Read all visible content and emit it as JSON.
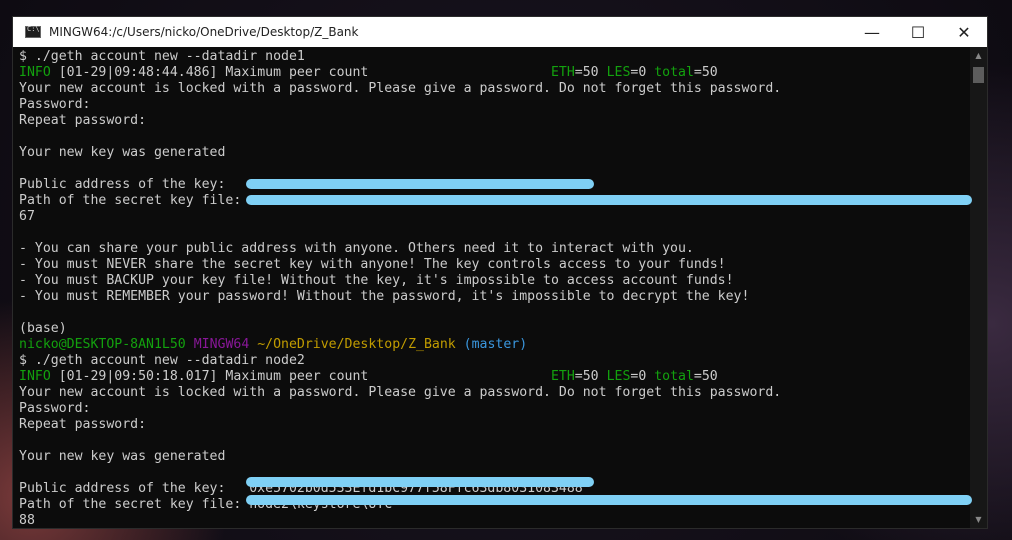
{
  "window": {
    "title": "MINGW64:/c/Users/nicko/OneDrive/Desktop/Z_Bank",
    "minimize": "—",
    "maximize": "☐",
    "close": "✕"
  },
  "terminal": {
    "lines": [
      {
        "kind": "cmd",
        "text": "$ ./geth account new --datadir node1"
      },
      {
        "kind": "info",
        "tag": "INFO",
        "text": " [01-29|09:48:44.486] Maximum peer count                       ",
        "k1": "ETH",
        "v1": "=50 ",
        "k2": "LES",
        "v2": "=0 ",
        "k3": "total",
        "v3": "=50"
      },
      {
        "kind": "plain",
        "text": "Your new account is locked with a password. Please give a password. Do not forget this password."
      },
      {
        "kind": "plain",
        "text": "Password:"
      },
      {
        "kind": "plain",
        "text": "Repeat password:"
      },
      {
        "kind": "plain",
        "text": ""
      },
      {
        "kind": "plain",
        "text": "Your new key was generated"
      },
      {
        "kind": "plain",
        "text": ""
      },
      {
        "kind": "plain",
        "text": "Public address of the key:"
      },
      {
        "kind": "plain",
        "text": "Path of the secret key file:"
      },
      {
        "kind": "plain",
        "text": "67"
      },
      {
        "kind": "plain",
        "text": ""
      },
      {
        "kind": "plain",
        "text": "- You can share your public address with anyone. Others need it to interact with you."
      },
      {
        "kind": "plain",
        "text": "- You must NEVER share the secret key with anyone! The key controls access to your funds!"
      },
      {
        "kind": "plain",
        "text": "- You must BACKUP your key file! Without the key, it's impossible to access account funds!"
      },
      {
        "kind": "plain",
        "text": "- You must REMEMBER your password! Without the password, it's impossible to decrypt the key!"
      },
      {
        "kind": "plain",
        "text": ""
      },
      {
        "kind": "plain",
        "text": "(base)"
      },
      {
        "kind": "prompt",
        "user": "nicko@DESKTOP-8AN1L50",
        "env": "MINGW64",
        "path": "~/OneDrive/Desktop/Z_Bank",
        "branch": "(master)"
      },
      {
        "kind": "cmd",
        "text": "$ ./geth account new --datadir node2"
      },
      {
        "kind": "info",
        "tag": "INFO",
        "text": " [01-29|09:50:18.017] Maximum peer count                       ",
        "k1": "ETH",
        "v1": "=50 ",
        "k2": "LES",
        "v2": "=0 ",
        "k3": "total",
        "v3": "=50"
      },
      {
        "kind": "plain",
        "text": "Your new account is locked with a password. Please give a password. Do not forget this password."
      },
      {
        "kind": "plain",
        "text": "Password:"
      },
      {
        "kind": "plain",
        "text": "Repeat password:"
      },
      {
        "kind": "plain",
        "text": ""
      },
      {
        "kind": "plain",
        "text": "Your new key was generated"
      },
      {
        "kind": "plain",
        "text": ""
      },
      {
        "kind": "plain",
        "text": "Public address of the key:   0xe5702b0d533Efd1bC977f58Ffc63db8031083488"
      },
      {
        "kind": "plain",
        "text": "Path of the secret key file: node2\\keystore\\UTC"
      },
      {
        "kind": "plain",
        "text": "88"
      }
    ]
  }
}
